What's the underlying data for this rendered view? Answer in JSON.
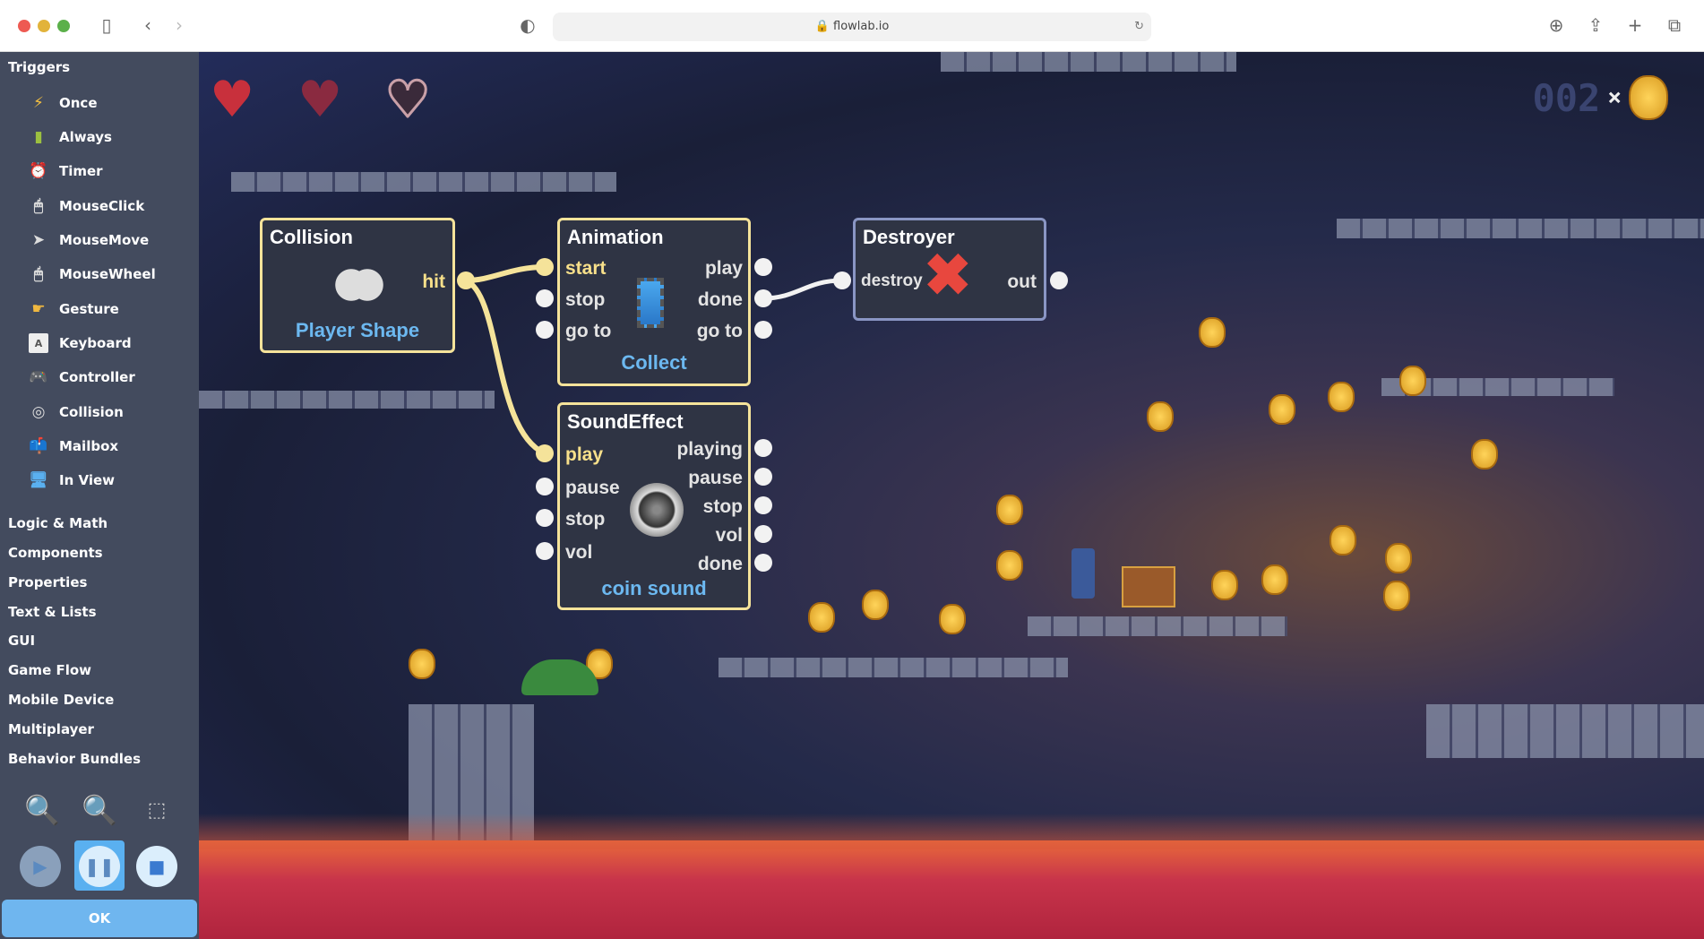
{
  "browser": {
    "url": "flowlab.io"
  },
  "sidebar": {
    "triggers_header": "Triggers",
    "triggers": [
      {
        "label": "Once",
        "icon": "lightning-icon"
      },
      {
        "label": "Always",
        "icon": "battery-icon"
      },
      {
        "label": "Timer",
        "icon": "alarm-clock-icon"
      },
      {
        "label": "MouseClick",
        "icon": "mouse-click-icon"
      },
      {
        "label": "MouseMove",
        "icon": "cursor-icon"
      },
      {
        "label": "MouseWheel",
        "icon": "mouse-wheel-icon"
      },
      {
        "label": "Gesture",
        "icon": "hand-icon"
      },
      {
        "label": "Keyboard",
        "icon": "key-icon"
      },
      {
        "label": "Controller",
        "icon": "gamepad-icon"
      },
      {
        "label": "Collision",
        "icon": "collision-icon"
      },
      {
        "label": "Mailbox",
        "icon": "mailbox-icon"
      },
      {
        "label": "In View",
        "icon": "monitor-icon"
      }
    ],
    "categories": [
      "Logic & Math",
      "Components",
      "Properties",
      "Text & Lists",
      "GUI",
      "Game Flow",
      "Mobile Device",
      "Multiplayer",
      "Behavior Bundles"
    ],
    "ok_label": "OK"
  },
  "hud": {
    "score": "002",
    "times": "×"
  },
  "nodes": {
    "collision": {
      "title": "Collision",
      "output": "hit",
      "name": "Player Shape"
    },
    "animation": {
      "title": "Animation",
      "inputs": [
        "start",
        "stop",
        "go to"
      ],
      "outputs": [
        "play",
        "done",
        "go to"
      ],
      "name": "Collect"
    },
    "sound": {
      "title": "SoundEffect",
      "inputs": [
        "play",
        "pause",
        "stop",
        "vol"
      ],
      "outputs": [
        "playing",
        "pause",
        "stop",
        "vol",
        "done"
      ],
      "name": "coin sound"
    },
    "destroyer": {
      "title": "Destroyer",
      "input": "destroy",
      "output": "out"
    }
  },
  "colors": {
    "active_wire": "#f5e39a",
    "wire": "#f2f2f2",
    "sidebar": "#434b5e",
    "accent": "#6fb6ef"
  }
}
